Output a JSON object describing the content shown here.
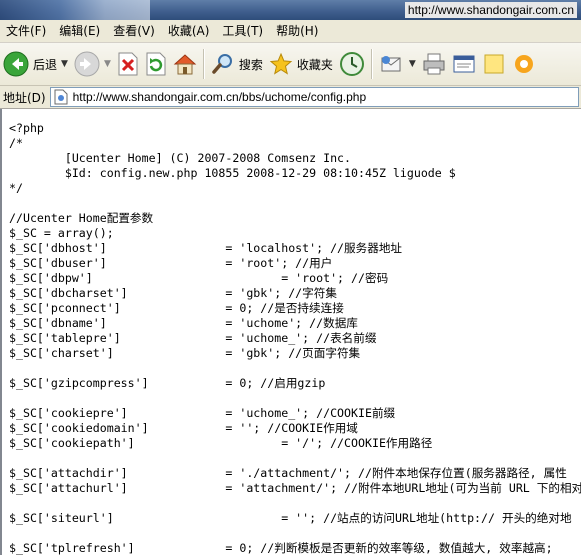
{
  "window": {
    "title": "http://www.shandongair.com.cn"
  },
  "menu": [
    "文件(F)",
    "编辑(E)",
    "查看(V)",
    "收藏(A)",
    "工具(T)",
    "帮助(H)"
  ],
  "toolbar": {
    "back_label": "后退",
    "search_label": "搜索",
    "favorites_label": "收藏夹"
  },
  "address": {
    "label": "地址(D)",
    "url": "http://www.shandongair.com.cn/bbs/uchome/config.php"
  },
  "file_lines": [
    "<?php",
    "/*",
    "        [Ucenter Home] (C) 2007-2008 Comsenz Inc.",
    "        $Id: config.new.php 10855 2008-12-29 08:10:45Z liguode $",
    "*/",
    "",
    "//Ucenter Home配置参数",
    "$_SC = array();",
    "$_SC['dbhost']                 = 'localhost'; //服务器地址",
    "$_SC['dbuser']                 = 'root'; //用户",
    "$_SC['dbpw']                           = 'root'; //密码",
    "$_SC['dbcharset']              = 'gbk'; //字符集",
    "$_SC['pconnect']               = 0; //是否持续连接",
    "$_SC['dbname']                 = 'uchome'; //数据库",
    "$_SC['tablepre']               = 'uchome_'; //表名前缀",
    "$_SC['charset']                = 'gbk'; //页面字符集",
    "",
    "$_SC['gzipcompress']           = 0; //启用gzip",
    "",
    "$_SC['cookiepre']              = 'uchome_'; //COOKIE前缀",
    "$_SC['cookiedomain']           = ''; //COOKIE作用域",
    "$_SC['cookiepath']                     = '/'; //COOKIE作用路径",
    "",
    "$_SC['attachdir']              = './attachment/'; //附件本地保存位置(服务器路径, 属性",
    "$_SC['attachurl']              = 'attachment/'; //附件本地URL地址(可为当前 URL 下的相对",
    "",
    "$_SC['siteurl']                        = ''; //站点的访问URL地址(http:// 开头的绝对地",
    "",
    "$_SC['tplrefresh']             = 0; //判断模板是否更新的效率等级, 数值越大, 效率越高;"
  ]
}
